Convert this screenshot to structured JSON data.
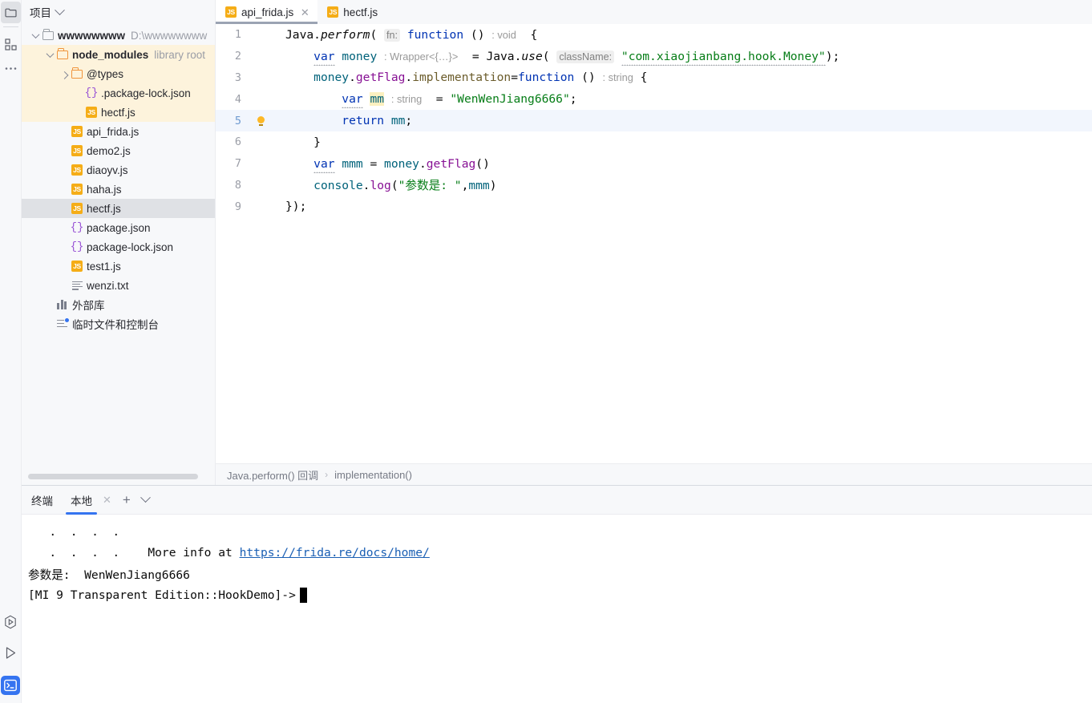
{
  "activity_bar": {
    "items": [
      {
        "name": "project-icon",
        "glyph": "folder",
        "active": true
      },
      {
        "name": "structure-icon",
        "glyph": "grid"
      },
      {
        "name": "more-tool-windows-icon",
        "glyph": "dots"
      }
    ],
    "bottom_items": [
      {
        "name": "run-with-coverage-icon",
        "glyph": "coverage"
      },
      {
        "name": "run-icon",
        "glyph": "play"
      },
      {
        "name": "terminal-icon",
        "glyph": "terminal",
        "active": true
      }
    ]
  },
  "project_panel": {
    "title": "项目",
    "tree": [
      {
        "label": "wwwwwwww",
        "suffix": "D:\\wwwwwwww",
        "icon": "folder",
        "indent": 0,
        "twisty": "open",
        "bold": true
      },
      {
        "label": "node_modules",
        "suffix": "library root",
        "icon": "folder-orange",
        "indent": 1,
        "twisty": "open",
        "lib": true,
        "bold": true
      },
      {
        "label": "@types",
        "suffix": "",
        "icon": "folder-orange",
        "indent": 2,
        "twisty": "closed",
        "lib": true
      },
      {
        "label": ".package-lock.json",
        "suffix": "",
        "icon": "json",
        "indent": 3,
        "twisty": "none",
        "lib": true
      },
      {
        "label": "hectf.js",
        "suffix": "",
        "icon": "js",
        "indent": 3,
        "twisty": "none",
        "lib": true
      },
      {
        "label": "api_frida.js",
        "suffix": "",
        "icon": "js",
        "indent": 2,
        "twisty": "none"
      },
      {
        "label": "demo2.js",
        "suffix": "",
        "icon": "js",
        "indent": 2,
        "twisty": "none"
      },
      {
        "label": "diaoyv.js",
        "suffix": "",
        "icon": "js",
        "indent": 2,
        "twisty": "none"
      },
      {
        "label": "haha.js",
        "suffix": "",
        "icon": "js",
        "indent": 2,
        "twisty": "none"
      },
      {
        "label": "hectf.js",
        "suffix": "",
        "icon": "js",
        "indent": 2,
        "twisty": "none",
        "selected": true
      },
      {
        "label": "package.json",
        "suffix": "",
        "icon": "json",
        "indent": 2,
        "twisty": "none"
      },
      {
        "label": "package-lock.json",
        "suffix": "",
        "icon": "json",
        "indent": 2,
        "twisty": "none"
      },
      {
        "label": "test1.js",
        "suffix": "",
        "icon": "js",
        "indent": 2,
        "twisty": "none"
      },
      {
        "label": "wenzi.txt",
        "suffix": "",
        "icon": "txt",
        "indent": 2,
        "twisty": "none"
      },
      {
        "label": "外部库",
        "suffix": "",
        "icon": "library",
        "indent": 1,
        "twisty": "none"
      },
      {
        "label": "临时文件和控制台",
        "suffix": "",
        "icon": "console",
        "indent": 1,
        "twisty": "none"
      }
    ]
  },
  "editor": {
    "tabs": [
      {
        "label": "api_frida.js",
        "icon": "js",
        "active": true,
        "closable": true,
        "close_glyph": "✕"
      },
      {
        "label": "hectf.js",
        "icon": "js",
        "active": false,
        "closable": false
      }
    ],
    "lines": [
      {
        "num": "1",
        "bulb": false
      },
      {
        "num": "2",
        "bulb": false
      },
      {
        "num": "3",
        "bulb": false
      },
      {
        "num": "4",
        "bulb": false
      },
      {
        "num": "5",
        "bulb": true,
        "current": true
      },
      {
        "num": "6",
        "bulb": false
      },
      {
        "num": "7",
        "bulb": false
      },
      {
        "num": "8",
        "bulb": false
      },
      {
        "num": "9",
        "bulb": false
      }
    ],
    "source_lines": [
      "Java.perform( fn: function () : void  {",
      "    var money : Wrapper<{…}>  = Java.use( className: \"com.xiaojianbang.hook.Money\");",
      "    money.getFlag.implementation=function () : string {",
      "        var mm : string  = \"WenWenJiang6666\";",
      "        return mm;",
      "    }",
      "    var mmm = money.getFlag()",
      "    console.log(\"参数是: \",mmm)",
      "});"
    ],
    "breadcrumb": {
      "items": [
        "Java.perform() 回调",
        "implementation()"
      ],
      "separator": "›"
    }
  },
  "terminal": {
    "title": "终端",
    "tab_label": "本地",
    "close_glyph": "✕",
    "add_glyph": "+",
    "options_glyph": "chevron-down",
    "lines": [
      {
        "text": "   .  .  .  ."
      },
      {
        "pre": "   .  .  .  .    More info at ",
        "link": "https://frida.re/docs/home/"
      },
      {
        "text": "参数是:  WenWenJiang6666"
      },
      {
        "prompt": "[MI 9 Transparent Edition::HookDemo]->",
        "cursor": true
      }
    ]
  },
  "colors": {
    "accent": "#3574f0",
    "panel_bg": "#f7f8fa",
    "editor_bg": "#ffffff",
    "library_root_bg": "#fdf3dc",
    "selected_row": "#dfe1e5",
    "current_line": "#f2f6fd",
    "string": "#067d17",
    "keyword": "#0033b3",
    "property": "#871094",
    "local_var": "#00627a",
    "js_icon": "#f5ad17"
  }
}
